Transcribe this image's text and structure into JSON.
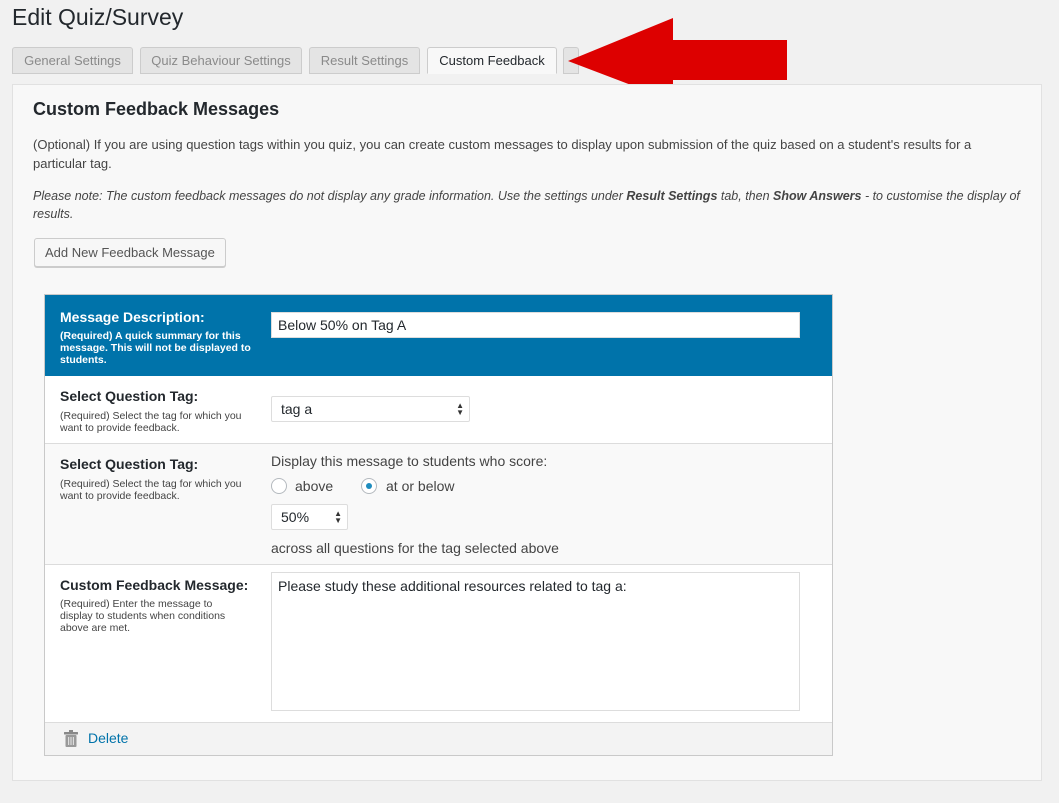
{
  "page": {
    "title": "Edit Quiz/Survey"
  },
  "tabs": [
    {
      "label": "General Settings",
      "active": false
    },
    {
      "label": "Quiz Behaviour Settings",
      "active": false
    },
    {
      "label": "Result Settings",
      "active": false
    },
    {
      "label": "Custom Feedback",
      "active": true
    }
  ],
  "annotation": {
    "arrow_color": "#dd0000"
  },
  "section": {
    "title": "Custom Feedback Messages",
    "intro": "(Optional) If you are using question tags within you quiz, you can create custom messages to display upon submission of the quiz based on a student's results for a particular tag.",
    "note_prefix": "Please note: The custom feedback messages do not display any grade information. Use the settings under ",
    "note_result_settings": "Result Settings",
    "note_mid": " tab, then ",
    "note_show_answers": "Show Answers",
    "note_suffix": " - to customise the display of results.",
    "add_button": "Add New Feedback Message"
  },
  "feedback": {
    "description": {
      "label": "Message Description:",
      "hint": "(Required) A quick summary for this message. This will not be displayed to students.",
      "value": "Below 50% on Tag A"
    },
    "tag": {
      "label": "Select Question Tag:",
      "hint": "(Required) Select the tag for which you want to provide feedback.",
      "selected": "tag a"
    },
    "score": {
      "label": "Select Question Tag:",
      "hint": "(Required) Select the tag for which you want to provide feedback.",
      "prompt": "Display this message to students who score:",
      "option_above": "above",
      "option_at_or_below": "at or below",
      "selected_option": "at or below",
      "percent": "50%",
      "suffix": "across all questions for the tag selected above"
    },
    "message": {
      "label": "Custom Feedback Message:",
      "hint": "(Required) Enter the message to display to students when conditions above are met.",
      "value": "Please study these additional resources related to tag a:"
    },
    "delete_label": "Delete"
  },
  "colors": {
    "header_blue": "#0073aa",
    "link_blue": "#0073aa",
    "radio_dot": "#1e8cbe"
  }
}
